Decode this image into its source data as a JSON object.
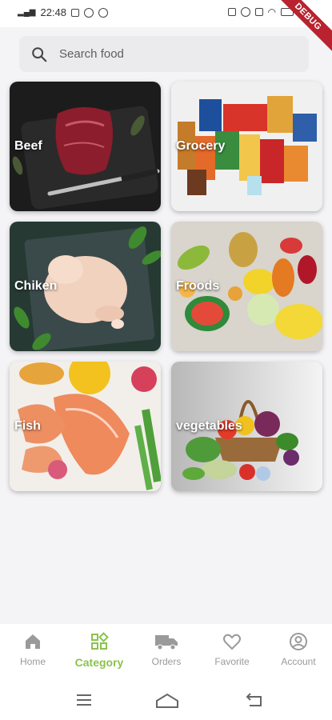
{
  "status_bar": {
    "time": "22:48",
    "debug_label": "DEBUG"
  },
  "search": {
    "placeholder": "Search food",
    "icon": "search-icon"
  },
  "categories": [
    {
      "label": "Beef"
    },
    {
      "label": "Grocery"
    },
    {
      "label": "Chiken"
    },
    {
      "label": "Froods"
    },
    {
      "label": "Fish"
    },
    {
      "label": "vegetables"
    }
  ],
  "bottom_nav": {
    "active_color": "#8bc34a",
    "items": [
      {
        "label": "Home",
        "icon": "home-icon"
      },
      {
        "label": "Category",
        "icon": "category-icon"
      },
      {
        "label": "Orders",
        "icon": "truck-icon"
      },
      {
        "label": "Favorite",
        "icon": "heart-icon"
      },
      {
        "label": "Account",
        "icon": "account-icon"
      }
    ]
  }
}
